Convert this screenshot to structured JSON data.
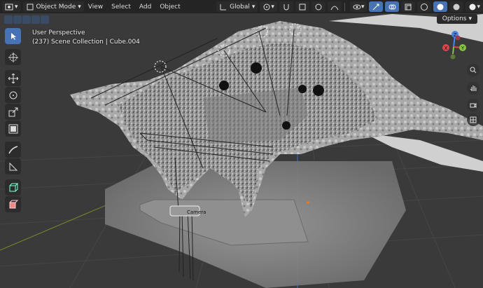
{
  "header": {
    "mode_label": "Object Mode",
    "menus": [
      "View",
      "Select",
      "Add",
      "Object"
    ],
    "transform_orientation": "Global"
  },
  "viewport": {
    "view_name": "User Perspective",
    "collection_info": "(237) Scene Collection | Cube.004",
    "options_label": "Options",
    "camera_label": "Camera"
  },
  "gizmo": {
    "z_label": "Z",
    "y_label": "Y",
    "x_label": "X"
  },
  "toolbar": {
    "tools": [
      "select-box-icon",
      "cursor-icon",
      "move-icon",
      "rotate-icon",
      "scale-icon",
      "transform-icon",
      "annotate-icon",
      "measure-icon",
      "add-cube-icon",
      "add-object-icon"
    ]
  },
  "colors": {
    "active_tool": "#4772b3",
    "x_axis": "#e0454d",
    "y_axis": "#85c43d",
    "z_axis": "#4a86e0"
  }
}
